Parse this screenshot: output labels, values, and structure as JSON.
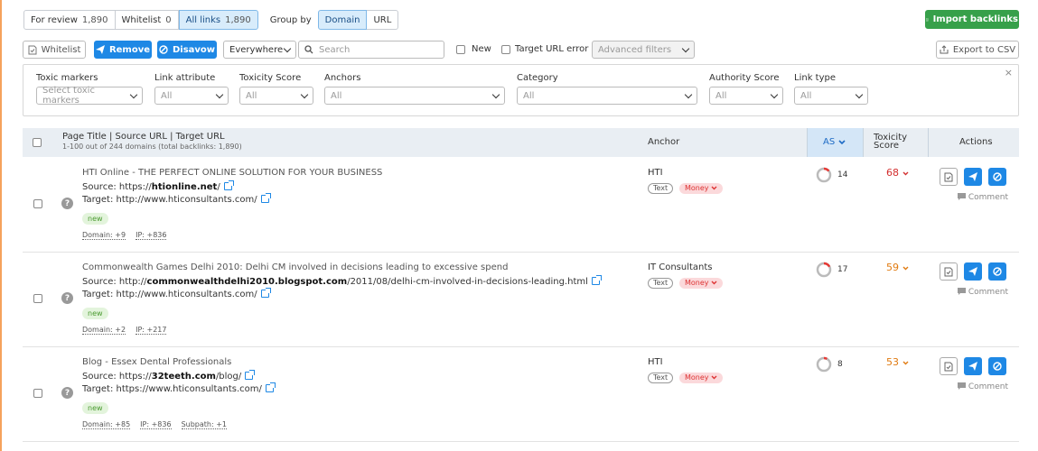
{
  "tabs": [
    {
      "label": "For review",
      "count": "1,890"
    },
    {
      "label": "Whitelist",
      "count": "0"
    },
    {
      "label": "All links",
      "count": "1,890"
    }
  ],
  "group_by": {
    "label": "Group by",
    "options": [
      "Domain",
      "URL"
    ]
  },
  "import_label": "Import backlinks",
  "toolbar": {
    "whitelist": "Whitelist",
    "remove": "Remove",
    "disavow": "Disavow",
    "everywhere": "Everywhere",
    "search_placeholder": "Search",
    "new_label": "New",
    "target_error": "Target URL error",
    "advanced_filters": "Advanced filters",
    "export": "Export to CSV"
  },
  "filters": [
    {
      "label": "Toxic markers",
      "value": "Select toxic markers"
    },
    {
      "label": "Link attribute",
      "value": "All"
    },
    {
      "label": "Toxicity Score",
      "value": "All"
    },
    {
      "label": "Anchors",
      "value": "All"
    },
    {
      "label": "Category",
      "value": "All"
    },
    {
      "label": "Authority Score",
      "value": "All"
    },
    {
      "label": "Link type",
      "value": "All"
    }
  ],
  "table": {
    "col_page": "Page Title | Source URL | Target URL",
    "col_sub": "1-100 out of 244 domains (total backlinks: 1,890)",
    "col_anchor": "Anchor",
    "col_as": "AS",
    "col_tox_line1": "Toxicity",
    "col_tox_line2": "Score",
    "col_actions": "Actions",
    "rows": [
      {
        "title": "HTI Online - THE PERFECT ONLINE SOLUTION FOR YOUR BUSINESS",
        "source_prefix": "Source: https://",
        "source_domain": "htionline.net",
        "source_rest": "/",
        "target": "Target: http://www.hticonsultants.com/",
        "badge": "new",
        "meta": [
          "Domain: +9",
          "IP: +836"
        ],
        "anchor": "HTI",
        "tag_text": "Text",
        "tag_money": "Money",
        "as": 14,
        "as_fill": 0.14,
        "tox": "68",
        "tox_color": "#d32f2f",
        "comment": "Comment"
      },
      {
        "title": "Commonwealth Games Delhi 2010: Delhi CM involved in decisions leading to excessive spend",
        "source_prefix": "Source: http://",
        "source_domain": "commonwealthdelhi2010.blogspot.com",
        "source_rest": "/2011/08/delhi-cm-involved-in-decisions-leading.html",
        "target": "Target: http://www.hticonsultants.com/",
        "badge": "new",
        "meta": [
          "Domain: +2",
          "IP: +217"
        ],
        "anchor": "IT Consultants",
        "tag_text": "Text",
        "tag_money": "Money",
        "as": 17,
        "as_fill": 0.17,
        "tox": "59",
        "tox_color": "#e07a10",
        "comment": "Comment"
      },
      {
        "title": "Blog - Essex Dental Professionals",
        "source_prefix": "Source: https://",
        "source_domain": "32teeth.com",
        "source_rest": "/blog/",
        "target": "Target: https://www.hticonsultants.com/",
        "badge": "new",
        "meta": [
          "Domain: +85",
          "IP: +836",
          "Subpath: +1"
        ],
        "anchor": "HTI",
        "tag_text": "Text",
        "tag_money": "Money",
        "as": 8,
        "as_fill": 0.08,
        "tox": "53",
        "tox_color": "#e07a10",
        "comment": "Comment"
      }
    ]
  }
}
